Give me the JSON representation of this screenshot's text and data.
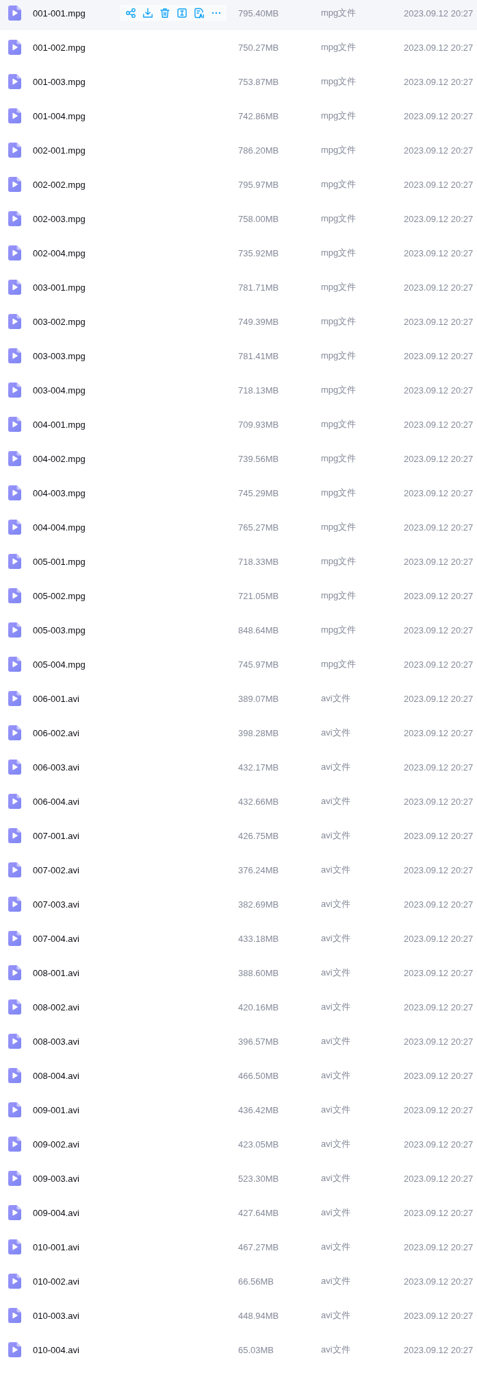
{
  "files": [
    {
      "name": "001-001.mpg",
      "size": "795.40MB",
      "type": "mpg文件",
      "modified": "2023.09.12 20:27",
      "hovered": true
    },
    {
      "name": "001-002.mpg",
      "size": "750.27MB",
      "type": "mpg文件",
      "modified": "2023.09.12 20:27",
      "hovered": false
    },
    {
      "name": "001-003.mpg",
      "size": "753.87MB",
      "type": "mpg文件",
      "modified": "2023.09.12 20:27",
      "hovered": false
    },
    {
      "name": "001-004.mpg",
      "size": "742.86MB",
      "type": "mpg文件",
      "modified": "2023.09.12 20:27",
      "hovered": false
    },
    {
      "name": "002-001.mpg",
      "size": "786.20MB",
      "type": "mpg文件",
      "modified": "2023.09.12 20:27",
      "hovered": false
    },
    {
      "name": "002-002.mpg",
      "size": "795.97MB",
      "type": "mpg文件",
      "modified": "2023.09.12 20:27",
      "hovered": false
    },
    {
      "name": "002-003.mpg",
      "size": "758.00MB",
      "type": "mpg文件",
      "modified": "2023.09.12 20:27",
      "hovered": false
    },
    {
      "name": "002-004.mpg",
      "size": "735.92MB",
      "type": "mpg文件",
      "modified": "2023.09.12 20:27",
      "hovered": false
    },
    {
      "name": "003-001.mpg",
      "size": "781.71MB",
      "type": "mpg文件",
      "modified": "2023.09.12 20:27",
      "hovered": false
    },
    {
      "name": "003-002.mpg",
      "size": "749.39MB",
      "type": "mpg文件",
      "modified": "2023.09.12 20:27",
      "hovered": false
    },
    {
      "name": "003-003.mpg",
      "size": "781.41MB",
      "type": "mpg文件",
      "modified": "2023.09.12 20:27",
      "hovered": false
    },
    {
      "name": "003-004.mpg",
      "size": "718.13MB",
      "type": "mpg文件",
      "modified": "2023.09.12 20:27",
      "hovered": false
    },
    {
      "name": "004-001.mpg",
      "size": "709.93MB",
      "type": "mpg文件",
      "modified": "2023.09.12 20:27",
      "hovered": false
    },
    {
      "name": "004-002.mpg",
      "size": "739.56MB",
      "type": "mpg文件",
      "modified": "2023.09.12 20:27",
      "hovered": false
    },
    {
      "name": "004-003.mpg",
      "size": "745.29MB",
      "type": "mpg文件",
      "modified": "2023.09.12 20:27",
      "hovered": false
    },
    {
      "name": "004-004.mpg",
      "size": "765.27MB",
      "type": "mpg文件",
      "modified": "2023.09.12 20:27",
      "hovered": false
    },
    {
      "name": "005-001.mpg",
      "size": "718.33MB",
      "type": "mpg文件",
      "modified": "2023.09.12 20:27",
      "hovered": false
    },
    {
      "name": "005-002.mpg",
      "size": "721.05MB",
      "type": "mpg文件",
      "modified": "2023.09.12 20:27",
      "hovered": false
    },
    {
      "name": "005-003.mpg",
      "size": "848.64MB",
      "type": "mpg文件",
      "modified": "2023.09.12 20:27",
      "hovered": false
    },
    {
      "name": "005-004.mpg",
      "size": "745.97MB",
      "type": "mpg文件",
      "modified": "2023.09.12 20:27",
      "hovered": false
    },
    {
      "name": "006-001.avi",
      "size": "389.07MB",
      "type": "avi文件",
      "modified": "2023.09.12 20:27",
      "hovered": false
    },
    {
      "name": "006-002.avi",
      "size": "398.28MB",
      "type": "avi文件",
      "modified": "2023.09.12 20:27",
      "hovered": false
    },
    {
      "name": "006-003.avi",
      "size": "432.17MB",
      "type": "avi文件",
      "modified": "2023.09.12 20:27",
      "hovered": false
    },
    {
      "name": "006-004.avi",
      "size": "432.66MB",
      "type": "avi文件",
      "modified": "2023.09.12 20:27",
      "hovered": false
    },
    {
      "name": "007-001.avi",
      "size": "426.75MB",
      "type": "avi文件",
      "modified": "2023.09.12 20:27",
      "hovered": false
    },
    {
      "name": "007-002.avi",
      "size": "376.24MB",
      "type": "avi文件",
      "modified": "2023.09.12 20:27",
      "hovered": false
    },
    {
      "name": "007-003.avi",
      "size": "382.69MB",
      "type": "avi文件",
      "modified": "2023.09.12 20:27",
      "hovered": false
    },
    {
      "name": "007-004.avi",
      "size": "433.18MB",
      "type": "avi文件",
      "modified": "2023.09.12 20:27",
      "hovered": false
    },
    {
      "name": "008-001.avi",
      "size": "388.60MB",
      "type": "avi文件",
      "modified": "2023.09.12 20:27",
      "hovered": false
    },
    {
      "name": "008-002.avi",
      "size": "420.16MB",
      "type": "avi文件",
      "modified": "2023.09.12 20:27",
      "hovered": false
    },
    {
      "name": "008-003.avi",
      "size": "396.57MB",
      "type": "avi文件",
      "modified": "2023.09.12 20:27",
      "hovered": false
    },
    {
      "name": "008-004.avi",
      "size": "466.50MB",
      "type": "avi文件",
      "modified": "2023.09.12 20:27",
      "hovered": false
    },
    {
      "name": "009-001.avi",
      "size": "436.42MB",
      "type": "avi文件",
      "modified": "2023.09.12 20:27",
      "hovered": false
    },
    {
      "name": "009-002.avi",
      "size": "423.05MB",
      "type": "avi文件",
      "modified": "2023.09.12 20:27",
      "hovered": false
    },
    {
      "name": "009-003.avi",
      "size": "523.30MB",
      "type": "avi文件",
      "modified": "2023.09.12 20:27",
      "hovered": false
    },
    {
      "name": "009-004.avi",
      "size": "427.64MB",
      "type": "avi文件",
      "modified": "2023.09.12 20:27",
      "hovered": false
    },
    {
      "name": "010-001.avi",
      "size": "467.27MB",
      "type": "avi文件",
      "modified": "2023.09.12 20:27",
      "hovered": false
    },
    {
      "name": "010-002.avi",
      "size": "66.56MB",
      "type": "avi文件",
      "modified": "2023.09.12 20:27",
      "hovered": false
    },
    {
      "name": "010-003.avi",
      "size": "448.94MB",
      "type": "avi文件",
      "modified": "2023.09.12 20:27",
      "hovered": false
    },
    {
      "name": "010-004.avi",
      "size": "65.03MB",
      "type": "avi文件",
      "modified": "2023.09.12 20:27",
      "hovered": false
    }
  ]
}
